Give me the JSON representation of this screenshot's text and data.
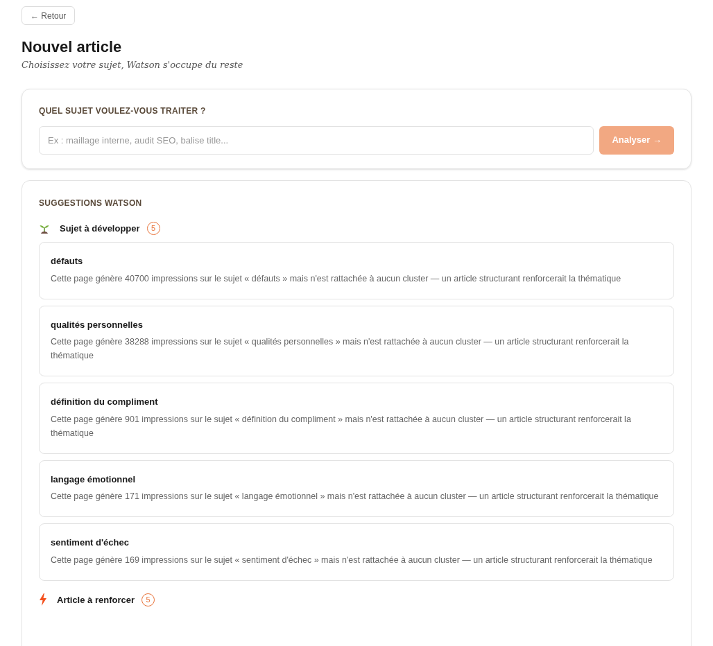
{
  "back_button": "← Retour",
  "title": "Nouvel article",
  "subtitle": "Choisissez votre sujet, Watson s'occupe du reste",
  "topic_panel": {
    "label": "QUEL SUJET VOULEZ-VOUS TRAITER ?",
    "placeholder": "Ex : maillage interne, audit SEO, balise title...",
    "button": "Analyser →",
    "button_disabled": true
  },
  "suggestions": {
    "title": "SUGGESTIONS WATSON",
    "groups": [
      {
        "kind": "sprout",
        "title": "Sujet à développer",
        "count": "5",
        "items": [
          {
            "title": "défauts",
            "description": "Cette page génère 40700 impressions sur le sujet « défauts » mais n'est rattachée à aucun cluster — un article structurant renforcerait la thématique"
          },
          {
            "title": "qualités personnelles",
            "description": "Cette page génère 38288 impressions sur le sujet « qualités personnelles » mais n'est rattachée à aucun cluster — un article structurant renforcerait la thématique"
          },
          {
            "title": "définition du compliment",
            "description": "Cette page génère 901 impressions sur le sujet « définition du compliment » mais n'est rattachée à aucun cluster — un article structurant renforcerait la thématique"
          },
          {
            "title": "langage émotionnel",
            "description": "Cette page génère 171 impressions sur le sujet « langage émotionnel » mais n'est rattachée à aucun cluster — un article structurant renforcerait la thématique"
          },
          {
            "title": "sentiment d'échec",
            "description": "Cette page génère 169 impressions sur le sujet « sentiment d'échec » mais n'est rattachée à aucun cluster — un article structurant renforcerait la thématique"
          }
        ]
      },
      {
        "kind": "bolt",
        "title": "Article à renforcer",
        "count": "5"
      }
    ]
  }
}
